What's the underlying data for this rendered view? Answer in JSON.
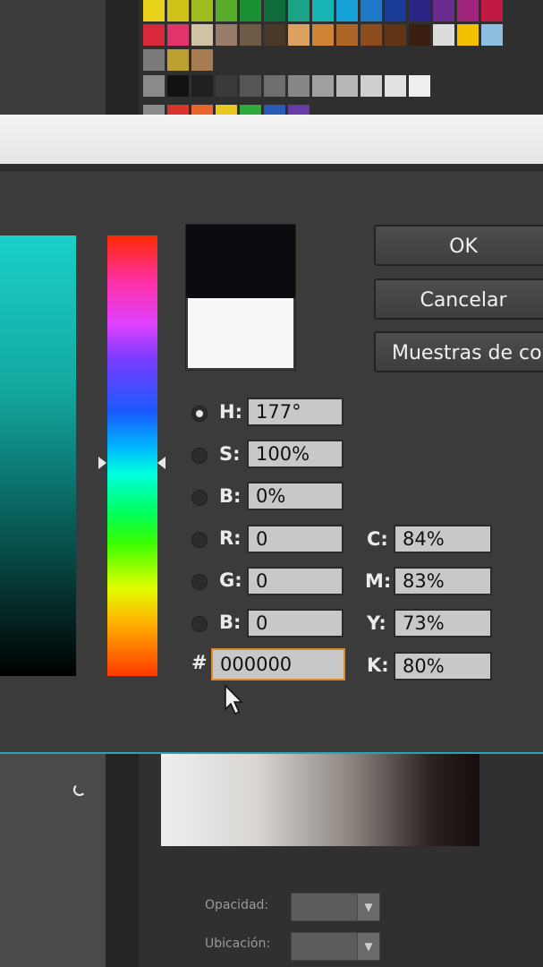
{
  "swatch_rows": [
    [
      "#e9d21c",
      "#d1c21a",
      "#9fbd1e",
      "#5aac2c",
      "#1a8f34",
      "#0e6b3a",
      "#1aa384",
      "#18b5b5",
      "#16a2d8",
      "#1e7ac6",
      "#183b95",
      "#2a2585",
      "#6a2b8e",
      "#a0257c",
      "#c01a44"
    ],
    [
      "#d82a3a",
      "#e2336b",
      "#cfc3a3",
      "#9a7c6a",
      "#6f5a45",
      "#4a3928",
      "#dca160",
      "#cf8438",
      "#b06528",
      "#8c4c1e",
      "#603415",
      "#3a1e10",
      "#dcdcdc",
      "#f3c000",
      "#8fbfe0"
    ],
    [
      "#7a7a7a",
      "#bca030",
      "#a87c50"
    ],
    [
      "#8a8a8a",
      "#111111",
      "#202020",
      "#3a3a3a",
      "#555555",
      "#6e6e6e",
      "#878787",
      "#a0a0a0",
      "#b8b8b8",
      "#cfcfcf",
      "#e2e2e2",
      "#efefef"
    ],
    [
      "#8a8a8a",
      "#d8352a",
      "#e8662a",
      "#e8c820",
      "#2eaa3a",
      "#2a5ab8",
      "#6a3aa8"
    ]
  ],
  "dialog": {
    "ok_label": "OK",
    "cancel_label": "Cancelar",
    "swatches_label": "Muestras de co",
    "selected_mode": "H",
    "hsb": [
      {
        "key": "h",
        "label": "H:",
        "value": "177°"
      },
      {
        "key": "s",
        "label": "S:",
        "value": "100%"
      },
      {
        "key": "b",
        "label": "B:",
        "value": "0%"
      }
    ],
    "rgb": [
      {
        "key": "r",
        "label": "R:",
        "value": "0"
      },
      {
        "key": "g",
        "label": "G:",
        "value": "0"
      },
      {
        "key": "b",
        "label": "B:",
        "value": "0"
      }
    ],
    "cmyk": [
      {
        "key": "c",
        "label": "C:",
        "value": "84%"
      },
      {
        "key": "m",
        "label": "M:",
        "value": "83%"
      },
      {
        "key": "y",
        "label": "Y:",
        "value": "73%"
      },
      {
        "key": "k",
        "label": "K:",
        "value": "80%"
      }
    ],
    "hex_label": "#",
    "hex_value": "000000",
    "new_color": "#0b0b10",
    "current_color": "#f8f8f8"
  },
  "background_panel": {
    "opacity_label": "Opacidad:",
    "location_label": "Ubicación:",
    "dropdown_icon": "triangle-down"
  }
}
